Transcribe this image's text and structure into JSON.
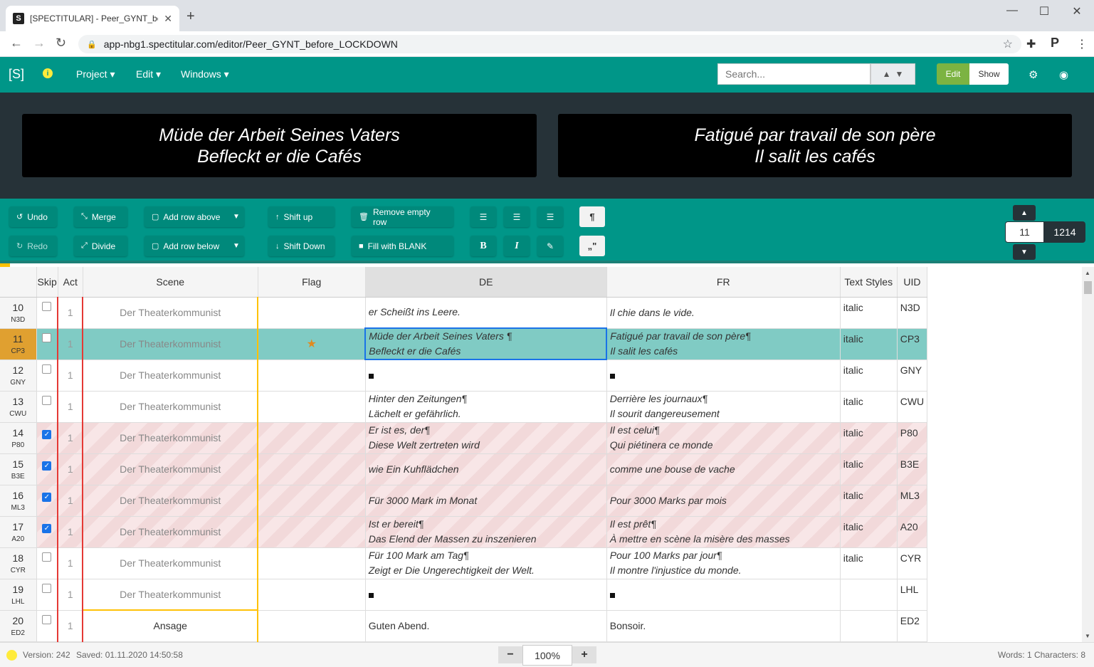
{
  "browser": {
    "tab_title": "[SPECTITULAR] - Peer_GYNT_before_LOCKDOWN",
    "url": "app-nbg1.spectitular.com/editor/Peer_GYNT_before_LOCKDOWN"
  },
  "header": {
    "brand": "[S]",
    "menus": [
      "Project",
      "Edit",
      "Windows"
    ],
    "search_placeholder": "Search...",
    "mode_edit": "Edit",
    "mode_show": "Show"
  },
  "preview": {
    "de": [
      "Müde der Arbeit Seines Vaters",
      "Befleckt er die Cafés"
    ],
    "fr": [
      "Fatigué par travail de son père",
      "Il salit les cafés"
    ]
  },
  "toolbar": {
    "undo": "Undo",
    "redo": "Redo",
    "merge": "Merge",
    "divide": "Divide",
    "add_above": "Add row above",
    "add_below": "Add row below",
    "shift_up": "Shift up",
    "shift_down": "Shift Down",
    "remove_empty": "Remove empty row",
    "fill_blank": "Fill with BLANK",
    "current_row": "11",
    "total_rows": "1214"
  },
  "columns": [
    "Skip",
    "Act",
    "Scene",
    "Flag",
    "DE",
    "FR",
    "Text Styles",
    "UID"
  ],
  "rows": [
    {
      "n": "10",
      "code": "N3D",
      "skip": false,
      "act": "1",
      "scene": "Der Theaterkommunist",
      "flag": "",
      "de": [
        "er Scheißt ins Leere."
      ],
      "fr": [
        "Il chie dans le vide."
      ],
      "style": "italic",
      "uid": "N3D"
    },
    {
      "n": "11",
      "code": "CP3",
      "skip": false,
      "act": "1",
      "scene": "Der Theaterkommunist",
      "flag": "★",
      "de": [
        "Müde der Arbeit Seines Vaters ¶",
        "Befleckt er die Cafés"
      ],
      "fr": [
        "Fatigué par travail de son père¶",
        "Il salit les cafés"
      ],
      "style": "italic",
      "uid": "CP3"
    },
    {
      "n": "12",
      "code": "GNY",
      "skip": false,
      "act": "1",
      "scene": "Der Theaterkommunist",
      "flag": "",
      "de": [],
      "fr": [],
      "style": "italic",
      "uid": "GNY"
    },
    {
      "n": "13",
      "code": "CWU",
      "skip": false,
      "act": "1",
      "scene": "Der Theaterkommunist",
      "flag": "",
      "de": [
        "Hinter den Zeitungen¶",
        "Lächelt er gefährlich."
      ],
      "fr": [
        "Derrière les journaux¶",
        "Il sourit dangereusement"
      ],
      "style": "italic",
      "uid": "CWU"
    },
    {
      "n": "14",
      "code": "P80",
      "skip": true,
      "act": "1",
      "scene": "Der Theaterkommunist",
      "flag": "",
      "de": [
        "Er ist es, der¶",
        "Diese Welt zertreten wird"
      ],
      "fr": [
        "Il est celui¶",
        "Qui piétinera ce monde"
      ],
      "style": "italic",
      "uid": "P80"
    },
    {
      "n": "15",
      "code": "B3E",
      "skip": true,
      "act": "1",
      "scene": "Der Theaterkommunist",
      "flag": "",
      "de": [
        "wie Ein Kuhflädchen"
      ],
      "fr": [
        "comme une bouse de vache"
      ],
      "style": "italic",
      "uid": "B3E"
    },
    {
      "n": "16",
      "code": "ML3",
      "skip": true,
      "act": "1",
      "scene": "Der Theaterkommunist",
      "flag": "",
      "de": [
        "Für 3000 Mark im Monat"
      ],
      "fr": [
        "Pour 3000 Marks par mois"
      ],
      "style": "italic",
      "uid": "ML3"
    },
    {
      "n": "17",
      "code": "A20",
      "skip": true,
      "act": "1",
      "scene": "Der Theaterkommunist",
      "flag": "",
      "de": [
        "Ist er bereit¶",
        "Das Elend der Massen zu inszenieren"
      ],
      "fr": [
        "Il est prêt¶",
        "À mettre en scène la misère des masses"
      ],
      "style": "italic",
      "uid": "A20"
    },
    {
      "n": "18",
      "code": "CYR",
      "skip": false,
      "act": "1",
      "scene": "Der Theaterkommunist",
      "flag": "",
      "de": [
        "Für 100 Mark am Tag¶",
        "Zeigt er Die Ungerechtigkeit der Welt."
      ],
      "fr": [
        "Pour 100 Marks par jour¶",
        "Il montre l'injustice du monde."
      ],
      "style": "italic",
      "uid": "CYR"
    },
    {
      "n": "19",
      "code": "LHL",
      "skip": false,
      "act": "1",
      "scene": "Der Theaterkommunist",
      "flag": "",
      "de": [],
      "fr": [],
      "style": "",
      "uid": "LHL"
    },
    {
      "n": "20",
      "code": "ED2",
      "skip": false,
      "act": "1",
      "scene": "Ansage",
      "flag": "",
      "de": [
        "Guten Abend."
      ],
      "fr": [
        "Bonsoir."
      ],
      "style": "",
      "uid": "ED2"
    }
  ],
  "status": {
    "version": "Version: 242",
    "saved": "Saved: 01.11.2020 14:50:58",
    "zoom": "100%",
    "counts": "Words: 1 Characters: 8"
  }
}
